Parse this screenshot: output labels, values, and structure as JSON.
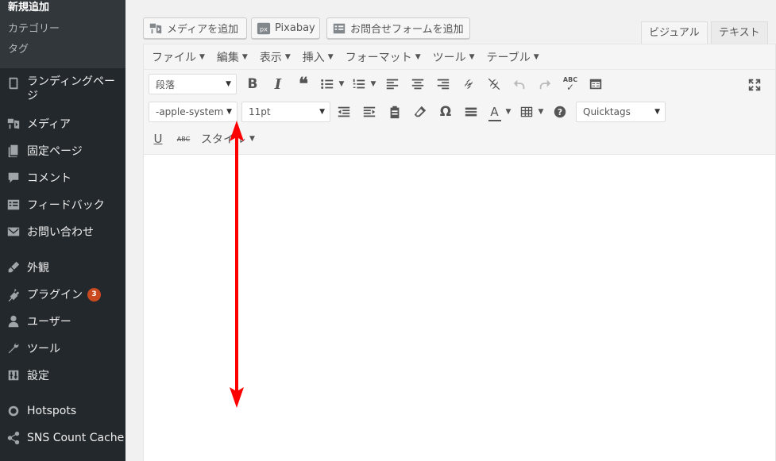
{
  "sidebar": {
    "submenu": [
      {
        "label": "新規追加",
        "current": true
      },
      {
        "label": "カテゴリー"
      },
      {
        "label": "タグ"
      }
    ],
    "items": [
      {
        "label": "ランディングページ",
        "icon": "book-icon"
      },
      {
        "label": "メディア",
        "icon": "media-icon"
      },
      {
        "label": "固定ページ",
        "icon": "pages-icon"
      },
      {
        "label": "コメント",
        "icon": "comment-icon"
      },
      {
        "label": "フィードバック",
        "icon": "feedback-icon"
      },
      {
        "label": "お問い合わせ",
        "icon": "mail-icon"
      },
      {
        "label": "外観",
        "icon": "brush-icon"
      },
      {
        "label": "プラグイン",
        "icon": "plugin-icon",
        "badge": "3"
      },
      {
        "label": "ユーザー",
        "icon": "user-icon"
      },
      {
        "label": "ツール",
        "icon": "wrench-icon"
      },
      {
        "label": "設定",
        "icon": "settings-icon"
      },
      {
        "label": "Hotspots",
        "icon": "circle-icon"
      },
      {
        "label": "SNS Count Cache",
        "icon": "share-icon"
      }
    ]
  },
  "media_buttons": {
    "add_media": "メディアを追加",
    "pixabay": "Pixabay",
    "contact_form": "お問合せフォームを追加"
  },
  "tabs": {
    "visual": "ビジュアル",
    "text": "テキスト"
  },
  "menubar": [
    "ファイル",
    "編集",
    "表示",
    "挿入",
    "フォーマット",
    "ツール",
    "テーブル"
  ],
  "toolbar": {
    "format_select": "段落",
    "font_family_select": "-apple-system",
    "font_size_select": "11pt",
    "quicktags_select": "Quicktags",
    "styles_label": "スタイル",
    "spellcheck_label": "ABC",
    "strike_label": "ABC",
    "omega": "Ω",
    "underline": "U",
    "text_color": "A",
    "bold": "B",
    "italic": "I"
  },
  "colors": {
    "sidebar_bg": "#23282d",
    "submenu_bg": "#32373c",
    "badge": "#ca4a1f",
    "annotation_arrow": "#ff0000"
  }
}
